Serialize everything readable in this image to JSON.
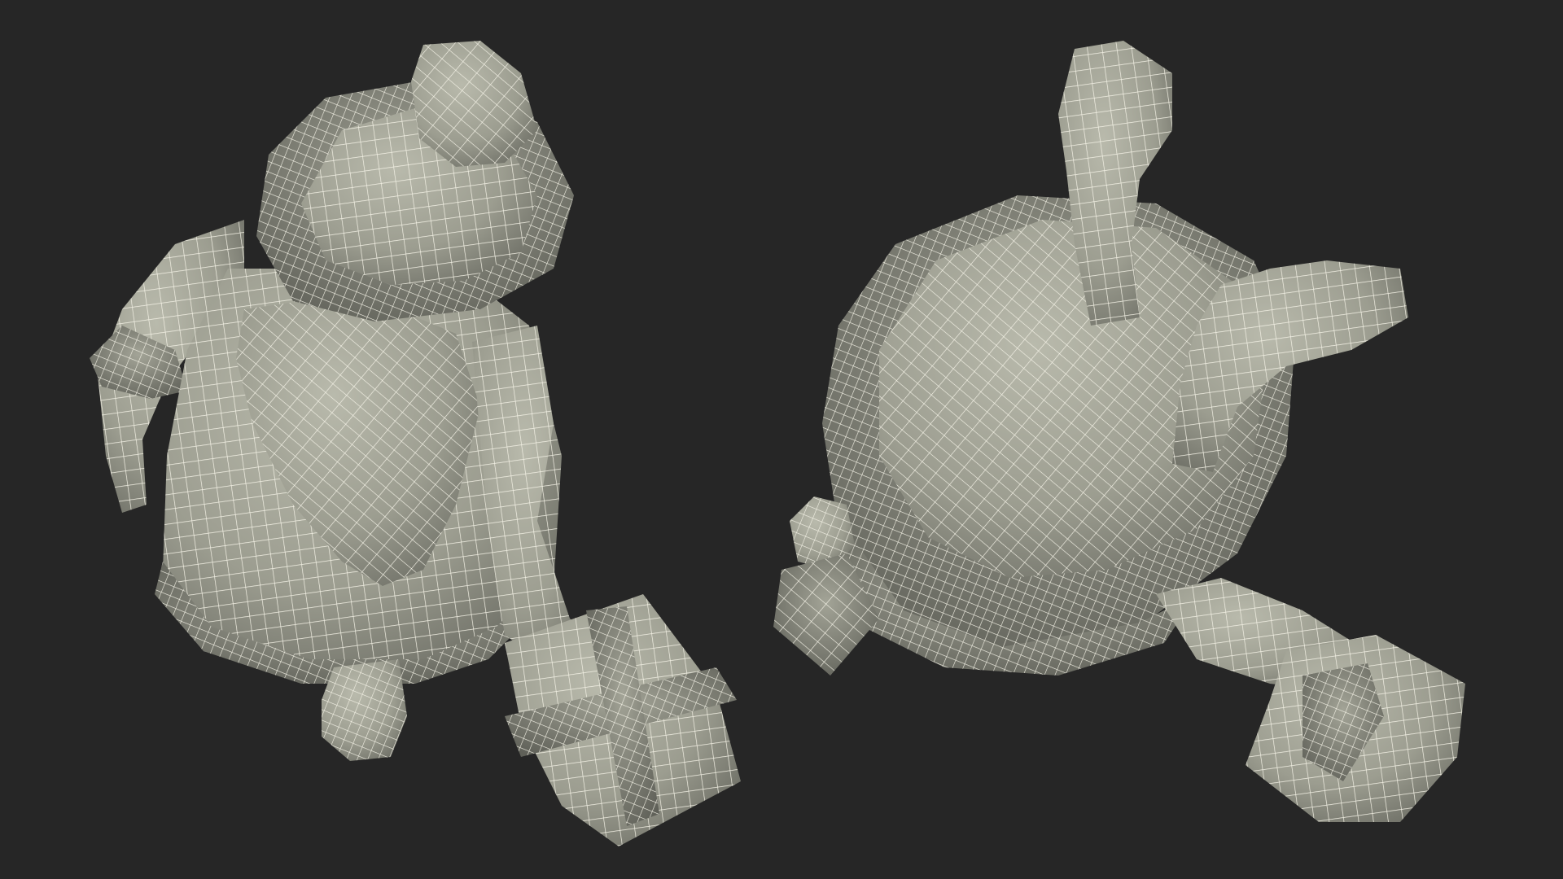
{
  "scene": {
    "background": "#262626",
    "surface_color": "#9c9d90",
    "surface_shadow": "#6e6f66",
    "surface_highlight": "#b9baac",
    "wire_color": "#f4f2e6"
  },
  "models": [
    {
      "view": "top-down",
      "subject": "santa-with-gift"
    },
    {
      "view": "bottom-up",
      "subject": "santa-with-gift"
    }
  ]
}
